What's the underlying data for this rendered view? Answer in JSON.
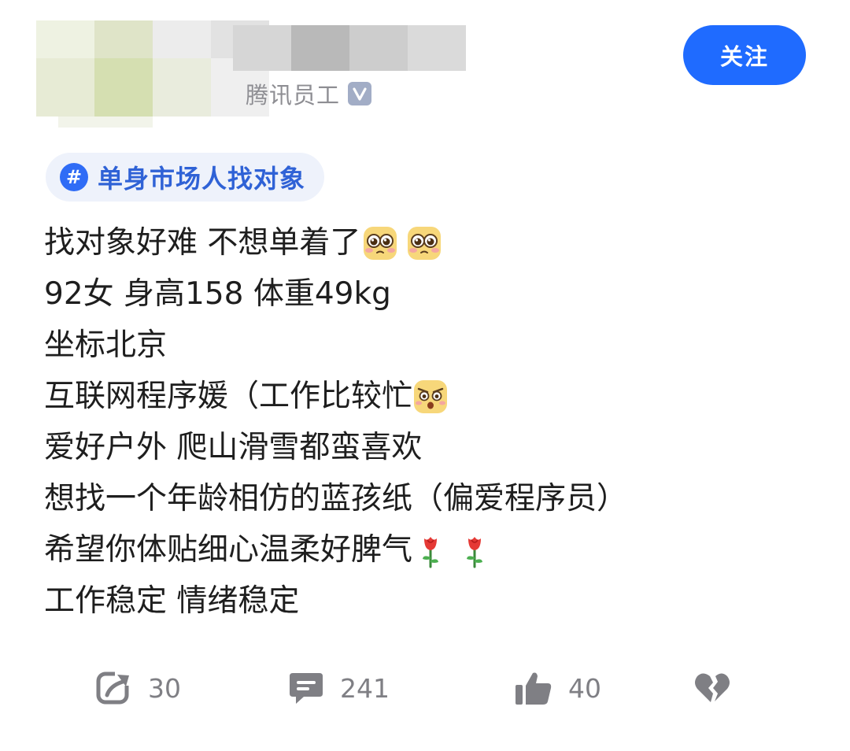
{
  "author": {
    "identity_label": "腾讯员工",
    "verified_icon": "verified-v-icon"
  },
  "follow_button": {
    "label": "关注",
    "color": "#1f6bff"
  },
  "topic": {
    "icon": "hash-icon",
    "label": "单身市场人找对象"
  },
  "post": {
    "lines": [
      {
        "text": "找对象好难 不想单着了",
        "emoji": [
          "pleading-face-emoji",
          "pleading-face-emoji"
        ]
      },
      {
        "text": "92女 身高158 体重49kg",
        "emoji": []
      },
      {
        "text": "坐标北京",
        "emoji": []
      },
      {
        "text": "互联网程序媛（工作比较忙",
        "emoji": [
          "stressed-face-emoji"
        ]
      },
      {
        "text": "爱好户外 爬山滑雪都蛮喜欢",
        "emoji": []
      },
      {
        "text": "想找一个年龄相仿的蓝孩纸（偏爱程序员）",
        "emoji": []
      },
      {
        "text": "希望你体贴细心温柔好脾气",
        "emoji": [
          "rose-emoji",
          "rose-emoji"
        ]
      },
      {
        "text": "工作稳定 情绪稳定",
        "emoji": []
      }
    ]
  },
  "actions": {
    "share": {
      "icon": "share-icon",
      "count": "30"
    },
    "comment": {
      "icon": "comment-icon",
      "count": "241"
    },
    "like": {
      "icon": "thumbs-up-icon",
      "count": "40"
    },
    "dislike": {
      "icon": "broken-heart-icon"
    }
  },
  "colors": {
    "accent": "#1f6bff",
    "topic_text": "#2f62d6",
    "muted_text": "#7f7f84"
  }
}
